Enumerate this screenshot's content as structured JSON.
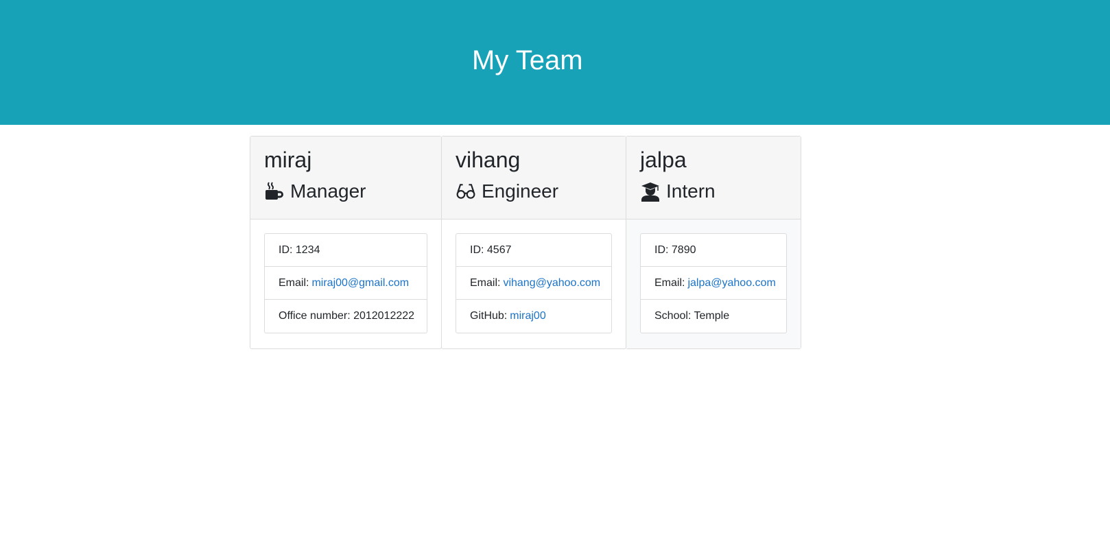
{
  "header": {
    "title": "My Team"
  },
  "cards": [
    {
      "name": "miraj",
      "role": "Manager",
      "role_icon": "coffee-mug-icon",
      "id_label": "ID: 1234",
      "email_prefix": "Email:",
      "email": "miraj00@gmail.com",
      "extra_label": "Office number: 2012012222"
    },
    {
      "name": "vihang",
      "role": "Engineer",
      "role_icon": "glasses-icon",
      "id_label": "ID: 4567",
      "email_prefix": "Email:",
      "email": "vihang@yahoo.com",
      "extra_prefix": "GitHub:",
      "extra_link": "miraj00"
    },
    {
      "name": "jalpa",
      "role": "Intern",
      "role_icon": "graduate-icon",
      "id_label": "ID: 7890",
      "email_prefix": "Email:",
      "email": "jalpa@yahoo.com",
      "extra_label": "School: Temple"
    }
  ],
  "colors": {
    "header_bg": "#17a2b8",
    "link": "#1a73c8"
  }
}
